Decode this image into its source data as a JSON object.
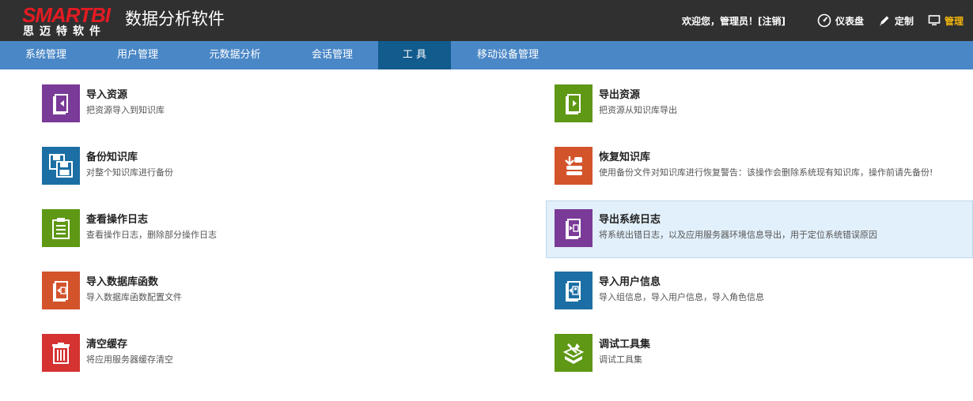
{
  "header": {
    "logo_main": "SMARTBI",
    "logo_sub": "思迈特软件",
    "app_title": "数据分析软件",
    "welcome": "欢迎您，管理员！[",
    "logout": "注销",
    "welcome_end": "]",
    "links": [
      {
        "label": "仪表盘",
        "icon": "dashboard-icon"
      },
      {
        "label": "定制",
        "icon": "pencil-icon"
      },
      {
        "label": "管理",
        "icon": "monitor-icon"
      }
    ],
    "active_color": "#f5b80c"
  },
  "nav": {
    "items": [
      "系统管理",
      "用户管理",
      "元数据分析",
      "会话管理",
      "工 具",
      "移动设备管理"
    ],
    "active_index": 4
  },
  "tools": [
    {
      "title": "导入资源",
      "desc": "把资源导入到知识库",
      "icon": "import-book-icon",
      "color": "#7a3a98"
    },
    {
      "title": "导出资源",
      "desc": "把资源从知识库导出",
      "icon": "export-book-icon",
      "color": "#5e9814"
    },
    {
      "title": "备份知识库",
      "desc": "对整个知识库进行备份",
      "icon": "floppy-disk-icon",
      "color": "#1b6fa4"
    },
    {
      "title": "恢复知识库",
      "desc": "使用备份文件对知识库进行恢复警告：该操作会删除系统现有知识库，操作前请先备份!",
      "icon": "restore-database-icon",
      "color": "#d3532b"
    },
    {
      "title": "查看操作日志",
      "desc": "查看操作日志，删除部分操作日志",
      "icon": "clipboard-log-icon",
      "color": "#5e9814"
    },
    {
      "title": "导出系统日志",
      "desc": "将系统出错日志，以及应用服务器环境信息导出，用于定位系统错误原因",
      "icon": "export-log-icon",
      "color": "#7a3a98"
    },
    {
      "title": "导入数据库函数",
      "desc": "导入数据库函数配置文件",
      "icon": "import-function-icon",
      "color": "#d3532b"
    },
    {
      "title": "导入用户信息",
      "desc": "导入组信息，导入用户信息，导入角色信息",
      "icon": "import-user-icon",
      "color": "#1b6fa4"
    },
    {
      "title": "清空缓存",
      "desc": "将应用服务器缓存清空",
      "icon": "trash-icon",
      "color": "#d53232"
    },
    {
      "title": "调试工具集",
      "desc": "调试工具集",
      "icon": "toolkit-icon",
      "color": "#5e9814"
    }
  ]
}
